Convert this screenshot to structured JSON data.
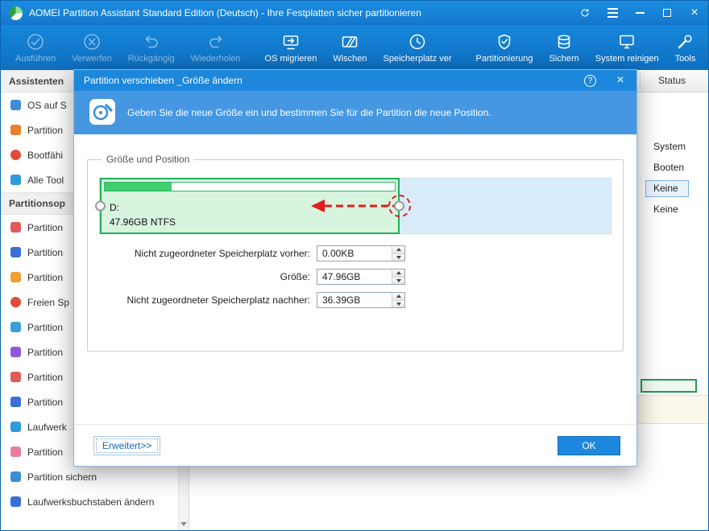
{
  "window": {
    "title": "AOMEI Partition Assistant Standard Edition (Deutsch) - Ihre Festplatten sicher partitionieren"
  },
  "titlebar": {
    "close_glyph": "×"
  },
  "toolbar": {
    "items": [
      {
        "label": "Ausführen",
        "disabled": true
      },
      {
        "label": "Verwerfen",
        "disabled": true
      },
      {
        "label": "Rückgängig",
        "disabled": true
      },
      {
        "label": "Wiederholen",
        "disabled": true
      },
      {
        "label": "OS migrieren",
        "disabled": false
      },
      {
        "label": "Wischen",
        "disabled": false
      },
      {
        "label": "Speicherplatz ver",
        "disabled": false
      },
      {
        "label": "Partitionierung",
        "disabled": false
      },
      {
        "label": "Sichern",
        "disabled": false
      },
      {
        "label": "System reinigen",
        "disabled": false
      },
      {
        "label": "Tools",
        "disabled": false
      }
    ]
  },
  "sidebar": {
    "sections": [
      {
        "header": "Assistenten",
        "items": [
          {
            "label": "OS auf S"
          },
          {
            "label": "Partition"
          },
          {
            "label": "Bootfähi"
          },
          {
            "label": "Alle Tool"
          }
        ]
      },
      {
        "header": "Partitionsop",
        "items": [
          {
            "label": "Partition"
          },
          {
            "label": "Partition"
          },
          {
            "label": "Partition"
          },
          {
            "label": "Freien Sp"
          },
          {
            "label": "Partition"
          },
          {
            "label": "Partition"
          },
          {
            "label": "Partition"
          },
          {
            "label": "Partition"
          },
          {
            "label": "Laufwerk"
          },
          {
            "label": "Partition"
          },
          {
            "label": "Partition sichern"
          },
          {
            "label": "Laufwerksbuchstaben ändern"
          }
        ]
      }
    ]
  },
  "content": {
    "status_header": "Status",
    "rows": [
      {
        "value": "System",
        "selected": false
      },
      {
        "value": "Booten",
        "selected": false
      },
      {
        "value": "Keine",
        "selected": true
      },
      {
        "value": "Keine",
        "selected": false
      }
    ]
  },
  "dialog": {
    "title": "Partition verschieben _Größe ändern",
    "help_glyph": "?",
    "close_glyph": "×",
    "subtitle": "Geben Sie die neue Größe ein und bestimmen Sie für die Partition die neue Position.",
    "group_title": "Größe und Position",
    "partition": {
      "name": "D:",
      "info": "47.96GB NTFS",
      "partition_percent": 59,
      "used_percent": 23
    },
    "fields": [
      {
        "label": "Nicht zugeordneter Speicherplatz vorher:",
        "value": "0.00KB"
      },
      {
        "label": "Größe:",
        "value": "47.96GB"
      },
      {
        "label": "Nicht zugeordneter Speicherplatz nachher:",
        "value": "36.39GB"
      }
    ],
    "advanced_label": "Erweitert>>",
    "ok_label": "OK"
  },
  "colors": {
    "titlebar": "#1a84d8",
    "dialog_header": "#4597e2",
    "accent": "#1e88e0",
    "partition_green_border": "#1fae57",
    "partition_green_fill": "#d7f4df",
    "used_fill": "#3ecf6e",
    "track_blue": "#d9ecfb",
    "drag_red": "#e11d1d"
  }
}
